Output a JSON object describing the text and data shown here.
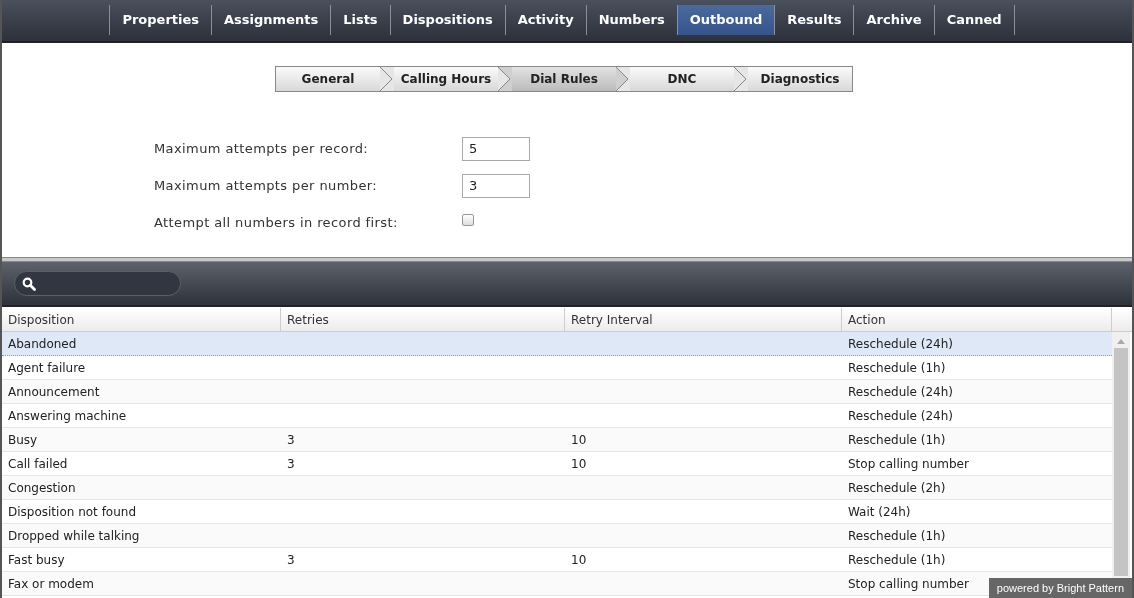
{
  "top_tabs": [
    {
      "label": "Properties",
      "selected": false
    },
    {
      "label": "Assignments",
      "selected": false
    },
    {
      "label": "Lists",
      "selected": false
    },
    {
      "label": "Dispositions",
      "selected": false
    },
    {
      "label": "Activity",
      "selected": false
    },
    {
      "label": "Numbers",
      "selected": false
    },
    {
      "label": "Outbound",
      "selected": true
    },
    {
      "label": "Results",
      "selected": false
    },
    {
      "label": "Archive",
      "selected": false
    },
    {
      "label": "Canned",
      "selected": false
    }
  ],
  "steps": [
    {
      "label": "General",
      "selected": false
    },
    {
      "label": "Calling Hours",
      "selected": false
    },
    {
      "label": "Dial Rules",
      "selected": true
    },
    {
      "label": "DNC",
      "selected": false
    },
    {
      "label": "Diagnostics",
      "selected": false
    }
  ],
  "form": [
    {
      "kind": "text",
      "label": "Maximum attempts per record:",
      "value": "5"
    },
    {
      "kind": "text",
      "label": "Maximum attempts per number:",
      "value": "3"
    },
    {
      "kind": "checkbox",
      "label": "Attempt all numbers in record first:",
      "checked": false
    }
  ],
  "table": {
    "columns": [
      "Disposition",
      "Retries",
      "Retry Interval",
      "Action"
    ],
    "rows": [
      {
        "disposition": "Abandoned",
        "action": "Reschedule (24h)",
        "selected": true
      },
      {
        "disposition": "Agent failure",
        "action": "Reschedule (1h)",
        "selected": false
      },
      {
        "disposition": "Announcement",
        "action": "Reschedule (24h)",
        "selected": false
      },
      {
        "disposition": "Answering machine",
        "action": "Reschedule (24h)",
        "selected": false
      },
      {
        "disposition": "Busy",
        "retries": "3",
        "retry_interval": "10",
        "action": "Reschedule (1h)",
        "selected": false
      },
      {
        "disposition": "Call failed",
        "retries": "3",
        "retry_interval": "10",
        "action": "Stop calling number",
        "selected": false
      },
      {
        "disposition": "Congestion",
        "action": "Reschedule (2h)",
        "selected": false
      },
      {
        "disposition": "Disposition not found",
        "action": "Wait (24h)",
        "selected": false
      },
      {
        "disposition": "Dropped while talking",
        "action": "Reschedule (1h)",
        "selected": false
      },
      {
        "disposition": "Fast busy",
        "retries": "3",
        "retry_interval": "10",
        "action": "Reschedule (1h)",
        "selected": false
      },
      {
        "disposition": "Fax or modem",
        "action": "Stop calling number",
        "selected": false
      }
    ]
  },
  "badge": "powered by Bright Pattern"
}
